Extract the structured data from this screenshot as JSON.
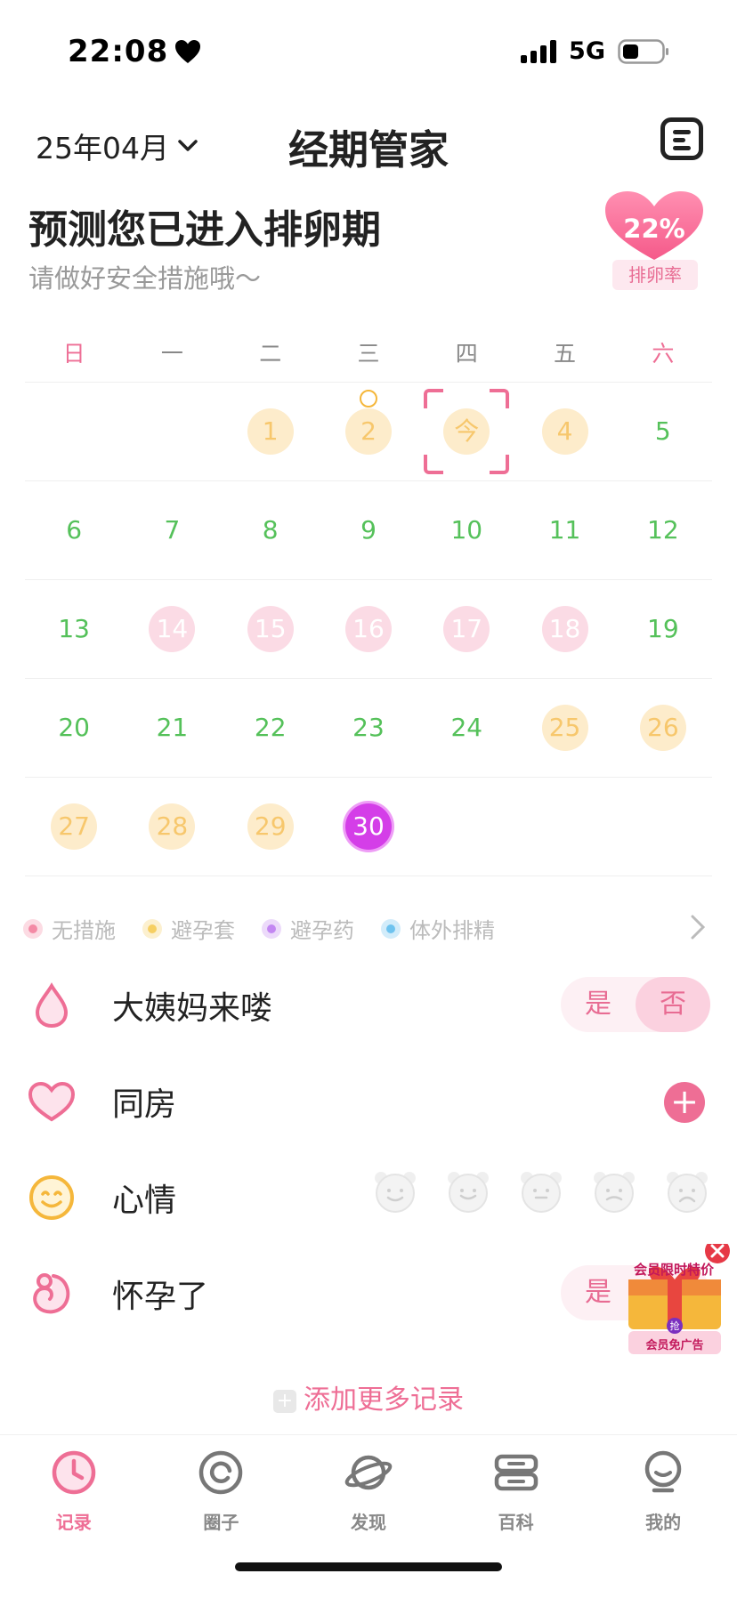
{
  "status_bar": {
    "time": "22:08",
    "network": "5G"
  },
  "header": {
    "month": "25年04月",
    "title": "经期管家"
  },
  "prediction": {
    "title": "预测您已进入排卵期",
    "subtitle": "请做好安全措施哦～",
    "ovulation_rate": "22%",
    "ovulation_label": "排卵率"
  },
  "calendar": {
    "weekdays": [
      "日",
      "一",
      "二",
      "三",
      "四",
      "五",
      "六"
    ],
    "weeks": [
      [
        {
          "label": "",
          "type": "empty"
        },
        {
          "label": "",
          "type": "empty"
        },
        {
          "label": "1",
          "type": "yellow"
        },
        {
          "label": "2",
          "type": "yellow",
          "mark": "smile"
        },
        {
          "label": "今",
          "type": "today"
        },
        {
          "label": "4",
          "type": "yellow"
        },
        {
          "label": "5",
          "type": "green"
        }
      ],
      [
        {
          "label": "6",
          "type": "green"
        },
        {
          "label": "7",
          "type": "green"
        },
        {
          "label": "8",
          "type": "green"
        },
        {
          "label": "9",
          "type": "green"
        },
        {
          "label": "10",
          "type": "green"
        },
        {
          "label": "11",
          "type": "green"
        },
        {
          "label": "12",
          "type": "green"
        }
      ],
      [
        {
          "label": "13",
          "type": "green"
        },
        {
          "label": "14",
          "type": "pink"
        },
        {
          "label": "15",
          "type": "pink"
        },
        {
          "label": "16",
          "type": "pink"
        },
        {
          "label": "17",
          "type": "pink"
        },
        {
          "label": "18",
          "type": "pink"
        },
        {
          "label": "19",
          "type": "green"
        }
      ],
      [
        {
          "label": "20",
          "type": "green"
        },
        {
          "label": "21",
          "type": "green"
        },
        {
          "label": "22",
          "type": "green"
        },
        {
          "label": "23",
          "type": "green"
        },
        {
          "label": "24",
          "type": "green"
        },
        {
          "label": "25",
          "type": "yellow"
        },
        {
          "label": "26",
          "type": "yellow"
        }
      ],
      [
        {
          "label": "27",
          "type": "yellow"
        },
        {
          "label": "28",
          "type": "yellow"
        },
        {
          "label": "29",
          "type": "yellow"
        },
        {
          "label": "30",
          "type": "purple"
        },
        {
          "label": "",
          "type": "empty"
        },
        {
          "label": "",
          "type": "empty"
        },
        {
          "label": "",
          "type": "empty"
        }
      ]
    ]
  },
  "legend": [
    {
      "label": "无措施",
      "color": "#f48aa5"
    },
    {
      "label": "避孕套",
      "color": "#f6cf62"
    },
    {
      "label": "避孕药",
      "color": "#c387f2"
    },
    {
      "label": "体外排精",
      "color": "#6ec3ef"
    }
  ],
  "records": {
    "period": {
      "label": "大姨妈来喽",
      "yes": "是",
      "no": "否"
    },
    "intimacy": {
      "label": "同房"
    },
    "mood": {
      "label": "心情"
    },
    "pregnant": {
      "label": "怀孕了",
      "yes": "是"
    },
    "add_more": "添加更多记录"
  },
  "ad": {
    "top_text": "会员限时特价",
    "badge": "抢",
    "bottom_text": "会员免广告"
  },
  "tabs": [
    {
      "label": "记录",
      "icon": "clock-icon",
      "active": true
    },
    {
      "label": "圈子",
      "icon": "circle-icon",
      "active": false
    },
    {
      "label": "发现",
      "icon": "planet-icon",
      "active": false
    },
    {
      "label": "百科",
      "icon": "book-icon",
      "active": false
    },
    {
      "label": "我的",
      "icon": "profile-icon",
      "active": false
    }
  ],
  "colors": {
    "accent": "#ee6e95",
    "fertile_green": "#55c15a",
    "period_pink": "#fbdbe5",
    "safe_yellow": "#fdeccb"
  }
}
